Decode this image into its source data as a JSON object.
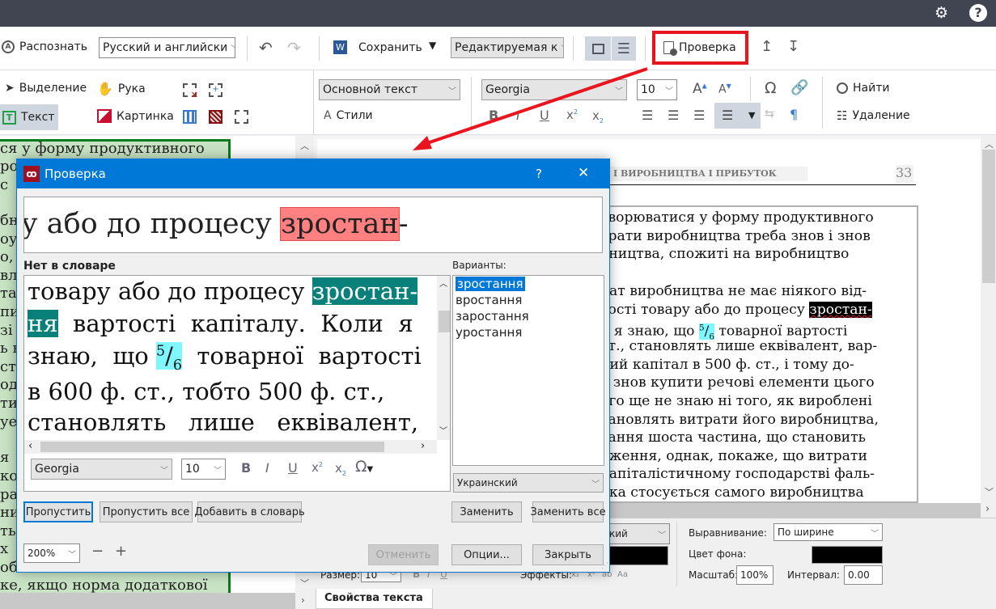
{
  "topbar": {
    "settings_icon": "gear-icon",
    "help_icon": "help-icon"
  },
  "toolbar1": {
    "recognize_label": "Распознать",
    "language_combo": "Русский и английски",
    "save_label": "Сохранить",
    "mode_combo": "Редактируемая к",
    "verify_label": "Проверка"
  },
  "toolbar2": {
    "select_label": "Выделение",
    "hand_label": "Рука",
    "text_label": "Текст",
    "picture_label": "Картинка",
    "style_combo": "Основной текст",
    "styles_label": "Стили",
    "font_combo": "Georgia",
    "size_combo": "10",
    "find_label": "Найти",
    "delete_label": "Удаление"
  },
  "left_image_lines": [
    "ся у форму продуктивного",
    "роб",
    "  с",
    "",
    "бн",
    "оу",
    "о,",
    "вл",
    "та",
    "пи",
    "  зі",
    "ь в",
    "ст",
    "оді",
    "ти",
    " уе",
    "",
    "   я",
    "ко",
    "ра",
    "ни",
    "ть",
    "х",
    "об",
    "ке, якщо норма додаткової"
  ],
  "document": {
    "header": "І ВИРОБНИЦТВА І ПРИБУТОК",
    "page_number": "33",
    "lines": [
      "творюватися у форму продуктивного",
      "трати виробництва треба знов і знов",
      "бництва,  спожиті  на  виробництво",
      "",
      "рат виробництва не має ніякого від-",
      "тості товару або до процесу ",
      "и я знаю, що ",
      "ст., становлять лише еквівалент, вар-",
      "ний капітал в 500 ф. ст., і тому до-",
      "б знов купити речові елементи цього",
      "ого ще не знаю ні того, як вироблені",
      "тановлять витрати його виробництва,",
      "тання шоста частина, що становить",
      "дження, однак, покаже, що витрати",
      " капіталістичному господарстві фаль-",
      " яка стосується самого виробництва"
    ],
    "highlight_word": "зростан-",
    "fraction_num": "5",
    "fraction_den": "6",
    "after_fraction": " товарної вартості"
  },
  "dialog": {
    "title": "Проверка",
    "help": "?",
    "close": "✕",
    "image_text_before": "у або до процесу ",
    "image_text_word": "зростан",
    "image_text_after": "-",
    "not_in_dict_label": "Нет в словаре",
    "edit_lines": {
      "l1_before": "товару або до процесу ",
      "l1_word": "зростан-",
      "l2_word": "ня",
      "l2_after": "  вартості  капіталу.  Коли  я",
      "l3_before": "знаю,  що ",
      "l3_num": "5",
      "l3_den": "6",
      "l3_after": "  товарної  вартості",
      "l4": "в 600 ф. ст., тобто 500 ф. ст.,",
      "l5": "становлять   лише   еквівалент,"
    },
    "font_combo": "Georgia",
    "size_combo": "10",
    "variants_label": "Варианты:",
    "variants": [
      "зростання",
      "вростання",
      "заростання",
      "уростання"
    ],
    "language_combo": "Украинский",
    "skip": "Пропустить",
    "skip_all": "Пропустить все",
    "add_to_dict": "Добавить в словарь",
    "replace": "Заменить",
    "replace_all": "Заменить все",
    "zoom_combo": "200%",
    "undo": "Отменить",
    "options": "Опции...",
    "close_btn": "Закрыть"
  },
  "properties": {
    "lang_combo_tail": "кий",
    "size_label": "Размер:",
    "size_value": "10",
    "effects_label": "Эффекты:",
    "align_label": "Выравнивание:",
    "align_value": "По ширине",
    "bgcolor_label": "Цвет фона:",
    "bgcolor": "#000000",
    "fgcolor": "#000000",
    "scale_label": "Масштаб:",
    "scale_value": "100%",
    "interval_label": "Интервал:",
    "interval_value": "0.00",
    "tab_label": "Свойства текста"
  },
  "colors": {
    "accent": "#0078d7",
    "annotation": "#e8141e",
    "error_highlight": "#ff8080",
    "selection_teal": "#0a807a"
  }
}
